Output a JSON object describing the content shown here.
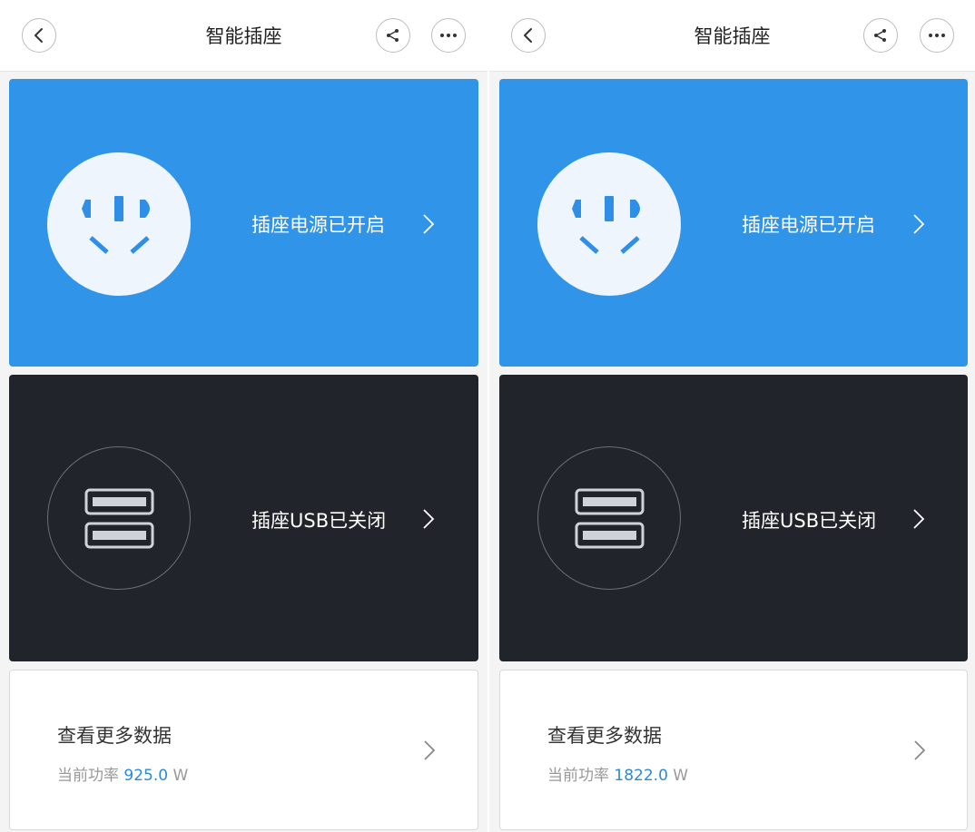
{
  "colors": {
    "accent_blue": "#3094e8",
    "usb_card_dark": "#21242a",
    "value_blue": "#2b8ad6"
  },
  "panes": [
    {
      "header": {
        "title": "智能插座",
        "back_icon": "back-icon",
        "share_icon": "share-icon",
        "more_icon": "more-icon"
      },
      "power_card": {
        "label": "插座电源已开启",
        "icon": "power-socket-icon",
        "state": "on"
      },
      "usb_card": {
        "label": "插座USB已关闭",
        "icon": "usb-port-icon",
        "state": "off"
      },
      "data_card": {
        "title": "查看更多数据",
        "power_label": "当前功率",
        "power_value": "925.0",
        "power_unit": "W"
      }
    },
    {
      "header": {
        "title": "智能插座",
        "back_icon": "back-icon",
        "share_icon": "share-icon",
        "more_icon": "more-icon"
      },
      "power_card": {
        "label": "插座电源已开启",
        "icon": "power-socket-icon",
        "state": "on"
      },
      "usb_card": {
        "label": "插座USB已关闭",
        "icon": "usb-port-icon",
        "state": "off"
      },
      "data_card": {
        "title": "查看更多数据",
        "power_label": "当前功率",
        "power_value": "1822.0",
        "power_unit": "W"
      }
    }
  ]
}
